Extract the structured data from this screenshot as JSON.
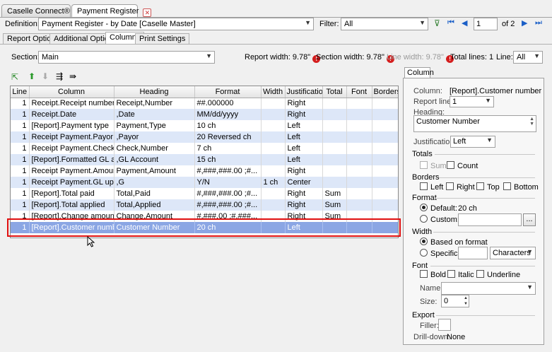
{
  "tabs": [
    {
      "label": "Caselle Connect®"
    },
    {
      "label": "Payment Register"
    }
  ],
  "definition": {
    "label": "Definition:",
    "value": "Payment Register - by Date [Caselle Master]"
  },
  "filter": {
    "label": "Filter:",
    "value": "All"
  },
  "pager": {
    "page": "1",
    "of": "of 2"
  },
  "subtabs": [
    "Report Options",
    "Additional Options",
    "Columns",
    "Print Settings"
  ],
  "section": {
    "label": "Section:",
    "value": "Main"
  },
  "info": {
    "report_width": "Report width: 9.78\"",
    "section_width": "Section width: 9.78\"",
    "line_width": "Line width: 9.78\"",
    "total_lines": "Total lines: 1",
    "line_label": "Line:",
    "line_value": "All"
  },
  "grid": {
    "headers": [
      "Line",
      "Column",
      "Heading",
      "Format",
      "Width",
      "Justification",
      "Total",
      "Font",
      "Borders"
    ],
    "rows": [
      [
        "1",
        "Receipt.Receipt number",
        "Receipt,Number",
        "##.000000",
        "",
        "Right",
        "",
        "",
        ""
      ],
      [
        "1",
        "Receipt.Date",
        ",Date",
        "MM/dd/yyyy",
        "",
        "Right",
        "",
        "",
        ""
      ],
      [
        "1",
        "[Report].Payment type",
        "Payment,Type",
        "10 ch",
        "",
        "Left",
        "",
        "",
        ""
      ],
      [
        "1",
        "Receipt Payment.Payor",
        ",Payor",
        "20 Reversed ch",
        "",
        "Left",
        "",
        "",
        ""
      ],
      [
        "1",
        "Receipt Payment.Check nu...",
        "Check,Number",
        "7 ch",
        "",
        "Left",
        "",
        "",
        ""
      ],
      [
        "1",
        "[Report].Formatted GL acc...",
        ",GL Account",
        "15 ch",
        "",
        "Left",
        "",
        "",
        ""
      ],
      [
        "1",
        "Receipt Payment.Amount",
        "Payment,Amount",
        "#,###,###.00 ;#...",
        "",
        "Right",
        "",
        "",
        ""
      ],
      [
        "1",
        "Receipt Payment.GL updated",
        ",G",
        "Y/N",
        "1 ch",
        "Center",
        "",
        "",
        ""
      ],
      [
        "1",
        "[Report].Total paid",
        "Total,Paid",
        "#,###,###.00 ;#...",
        "",
        "Right",
        "Sum",
        "",
        ""
      ],
      [
        "1",
        "[Report].Total applied",
        "Total,Applied",
        "#,###,###.00 ;#...",
        "",
        "Right",
        "Sum",
        "",
        ""
      ],
      [
        "1",
        "[Report].Change amount",
        "Change,Amount",
        "#,###.00 ;#,###...",
        "",
        "Right",
        "Sum",
        "",
        ""
      ],
      [
        "1",
        "[Report].Customer number",
        "Customer Number",
        "20 ch",
        "",
        "Left",
        "",
        "",
        ""
      ]
    ]
  },
  "panel": {
    "tab": "Column",
    "column_label": "Column:",
    "column_value": "[Report].Customer number",
    "report_line_label": "Report line:",
    "report_line_value": "1",
    "heading_label": "Heading:",
    "heading_value": "Customer Number",
    "justification_label": "Justification:",
    "justification_value": "Left",
    "totals": "Totals",
    "sum": "Sum",
    "count": "Count",
    "borders": "Borders",
    "left": "Left",
    "right": "Right",
    "top": "Top",
    "bottom": "Bottom",
    "format": "Format",
    "default_label": "Default:",
    "default_value": "20 ch",
    "custom_label": "Custom:",
    "custom_btn": "...",
    "width": "Width",
    "based_on_format": "Based on format",
    "specific_label": "Specific:",
    "specific_unit": "Characters",
    "font": "Font",
    "bold": "Bold",
    "italic": "Italic",
    "underline": "Underline",
    "name_label": "Name:",
    "size_label": "Size:",
    "size_value": "0",
    "export": "Export",
    "filler_label": "Filler:",
    "drilldown_label": "Drill-down:",
    "drilldown_value": "None"
  }
}
